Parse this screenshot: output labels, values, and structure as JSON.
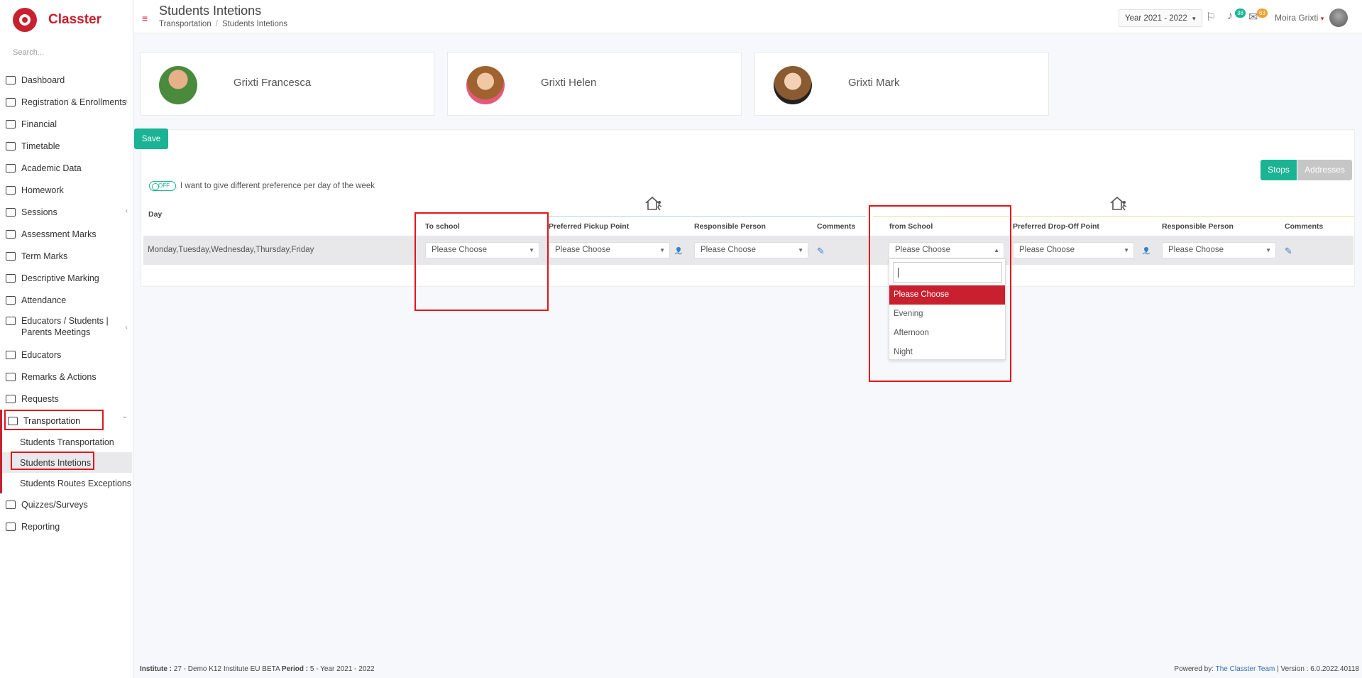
{
  "app": {
    "name": "Classter",
    "search_placeholder": "Search..."
  },
  "sidebar": {
    "items": [
      {
        "label": "Dashboard",
        "icon": "laptop-icon"
      },
      {
        "label": "Registration & Enrollments",
        "icon": "institution-icon",
        "has_children": true
      },
      {
        "label": "Financial",
        "icon": "money-icon"
      },
      {
        "label": "Timetable",
        "icon": "calendar-icon"
      },
      {
        "label": "Academic Data",
        "icon": "id-card-icon"
      },
      {
        "label": "Homework",
        "icon": "list-icon"
      },
      {
        "label": "Sessions",
        "icon": "users-icon",
        "has_children": true
      },
      {
        "label": "Assessment Marks",
        "icon": "edit-icon"
      },
      {
        "label": "Term Marks",
        "icon": "book-icon"
      },
      {
        "label": "Descriptive Marking",
        "icon": "pencil-icon"
      },
      {
        "label": "Attendance",
        "icon": "user-check-icon"
      },
      {
        "label": "Educators / Students | Parents Meetings",
        "icon": "meeting-icon",
        "has_children": true
      },
      {
        "label": "Educators",
        "icon": "user-tie-icon"
      },
      {
        "label": "Remarks & Actions",
        "icon": "random-icon"
      },
      {
        "label": "Requests",
        "icon": "file-icon"
      },
      {
        "label": "Transportation",
        "icon": "bus-icon",
        "expanded": true
      },
      {
        "label": "Quizzes/Surveys",
        "icon": "clipboard-icon"
      },
      {
        "label": "Reporting",
        "icon": "print-icon"
      }
    ],
    "transportation_sub": [
      "Students Transportation",
      "Students Intetions",
      "Students Routes Exceptions"
    ],
    "chevron": "‹",
    "chevron_down": "⌄"
  },
  "header": {
    "title": "Students Intetions",
    "breadcrumb": [
      "Transportation",
      "Students Intetions"
    ],
    "breadcrumb_sep": "/",
    "year": "Year 2021 - 2022",
    "notifications_count": "38",
    "messages_count": "63",
    "user_name": "Moira Grixti",
    "menu_glyph": "≡",
    "flag_glyph": "⚐",
    "bell_glyph": "♪",
    "mail_glyph": "✉",
    "caret_glyph": "▾"
  },
  "students": [
    "Grixti Francesca",
    "Grixti Helen",
    "Grixti Mark"
  ],
  "form": {
    "save_label": "Save",
    "stops_label": "Stops",
    "addresses_label": "Addresses",
    "toggle_state": "OFF",
    "toggle_label": "I want to give different preference per day of the week",
    "day_header": "Day",
    "columns": [
      "To school",
      "Preferred Pickup Point",
      "Responsible Person",
      "Comments",
      "from School",
      "Preferred Drop-Off Point",
      "Responsible Person",
      "Comments"
    ],
    "row_days": "Monday,Tuesday,Wednesday,Thursday,Friday",
    "select_placeholder": "Please Choose",
    "edit_glyph": "✎",
    "dropdown_arrow": "▼",
    "dropdown_arrow_up": "▲",
    "dropdown_options": [
      "Please Choose",
      "Evening",
      "Afternoon",
      "Night"
    ]
  },
  "footer": {
    "institute_label": "Institute :",
    "institute_value": "27 - Demo K12 Institute EU BETA",
    "period_label": "Period :",
    "period_value": "5 - Year 2021 - 2022",
    "powered_by": "Powered by:",
    "team": "The Classter Team",
    "version": "| Version : 6.0.2022.40118"
  },
  "colors": {
    "brand": "#c8202f",
    "accent": "#1ab394",
    "highlight": "#e3141b"
  }
}
